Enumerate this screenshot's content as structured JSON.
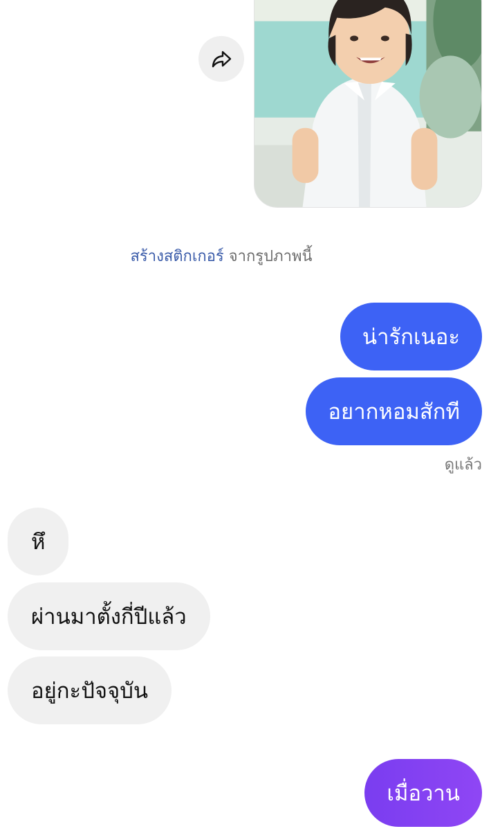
{
  "shared_photo": {
    "share_icon": "share-arrow-icon"
  },
  "sticker_prompt": {
    "link": "สร้างสติกเกอร์",
    "rest": " จากรูปภาพนี้"
  },
  "messages": [
    {
      "from": "me",
      "text": "น่ารักเนอะ"
    },
    {
      "from": "me",
      "text": "อยากหอมสักที"
    },
    {
      "from": "other",
      "text": "หึ"
    },
    {
      "from": "other",
      "text": "ผ่านมาตั้งกี่ปีแล้ว"
    },
    {
      "from": "other",
      "text": "อยู่กะปัจจุบัน"
    },
    {
      "from": "me",
      "text": "เมื่อวาน"
    }
  ],
  "read_receipt": "ดูแล้ว",
  "colors": {
    "outgoing_bubble": "#3d62f5",
    "outgoing_latest_bubble": "#8f46f4",
    "incoming_bubble": "#f0f0f0",
    "link": "#3a5ba9"
  }
}
